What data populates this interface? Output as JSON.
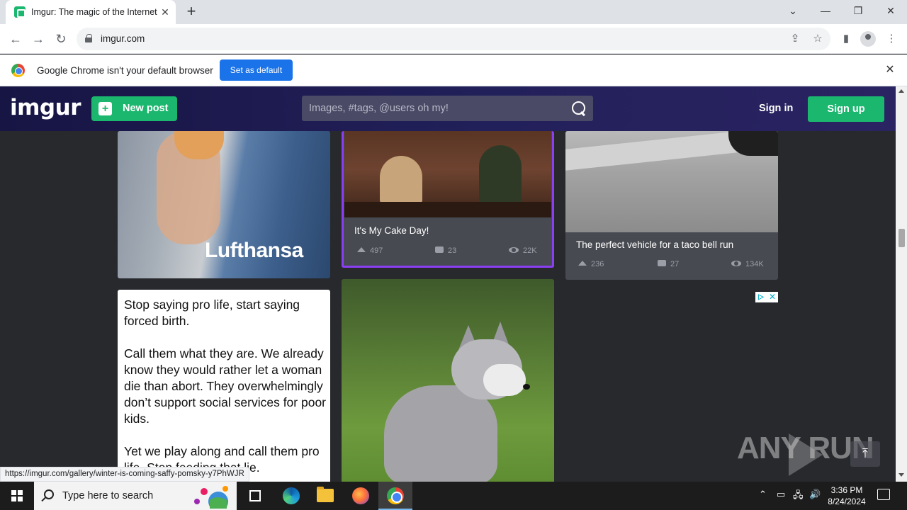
{
  "browser": {
    "tab_title": "Imgur: The magic of the Internet",
    "tab_close": "✕",
    "new_tab": "+",
    "url": "imgur.com",
    "infobar_text": "Google Chrome isn't your default browser",
    "set_default_label": "Set as default",
    "infobar_close": "✕"
  },
  "header": {
    "logo": "imgur",
    "new_post_label": "New post",
    "search_placeholder": "Images, #tags, @users oh my!",
    "sign_in": "Sign in",
    "sign_up": "Sign up",
    "accent": "#1bb76e"
  },
  "posts": {
    "lufthansa_caption": "Lufthansa",
    "cake": {
      "title": "It's My Cake Day!",
      "upvotes": "497",
      "comments": "23",
      "views": "22K",
      "highlight": "#8b3ff2"
    },
    "taco": {
      "title": "The perfect vehicle for a taco bell run",
      "upvotes": "236",
      "comments": "27",
      "views": "134K"
    },
    "text_post": {
      "para1": "Stop saying pro life, start saying forced birth.",
      "para2": "Call them what they are. We already know they would rather let a woman die than abort. They overwhelmingly don’t support social services for poor kids.",
      "para3": "Yet we play along and call them pro life. Stop feeding that lie."
    }
  },
  "ad": {
    "info": "▷",
    "close": "✕"
  },
  "status_url": "https://imgur.com/gallery/winter-is-coming-saffy-pomsky-y7PhWJR",
  "watermark": "ANY RUN",
  "taskbar": {
    "search_text": "Type here to search",
    "time": "3:36 PM",
    "date": "8/24/2024"
  }
}
